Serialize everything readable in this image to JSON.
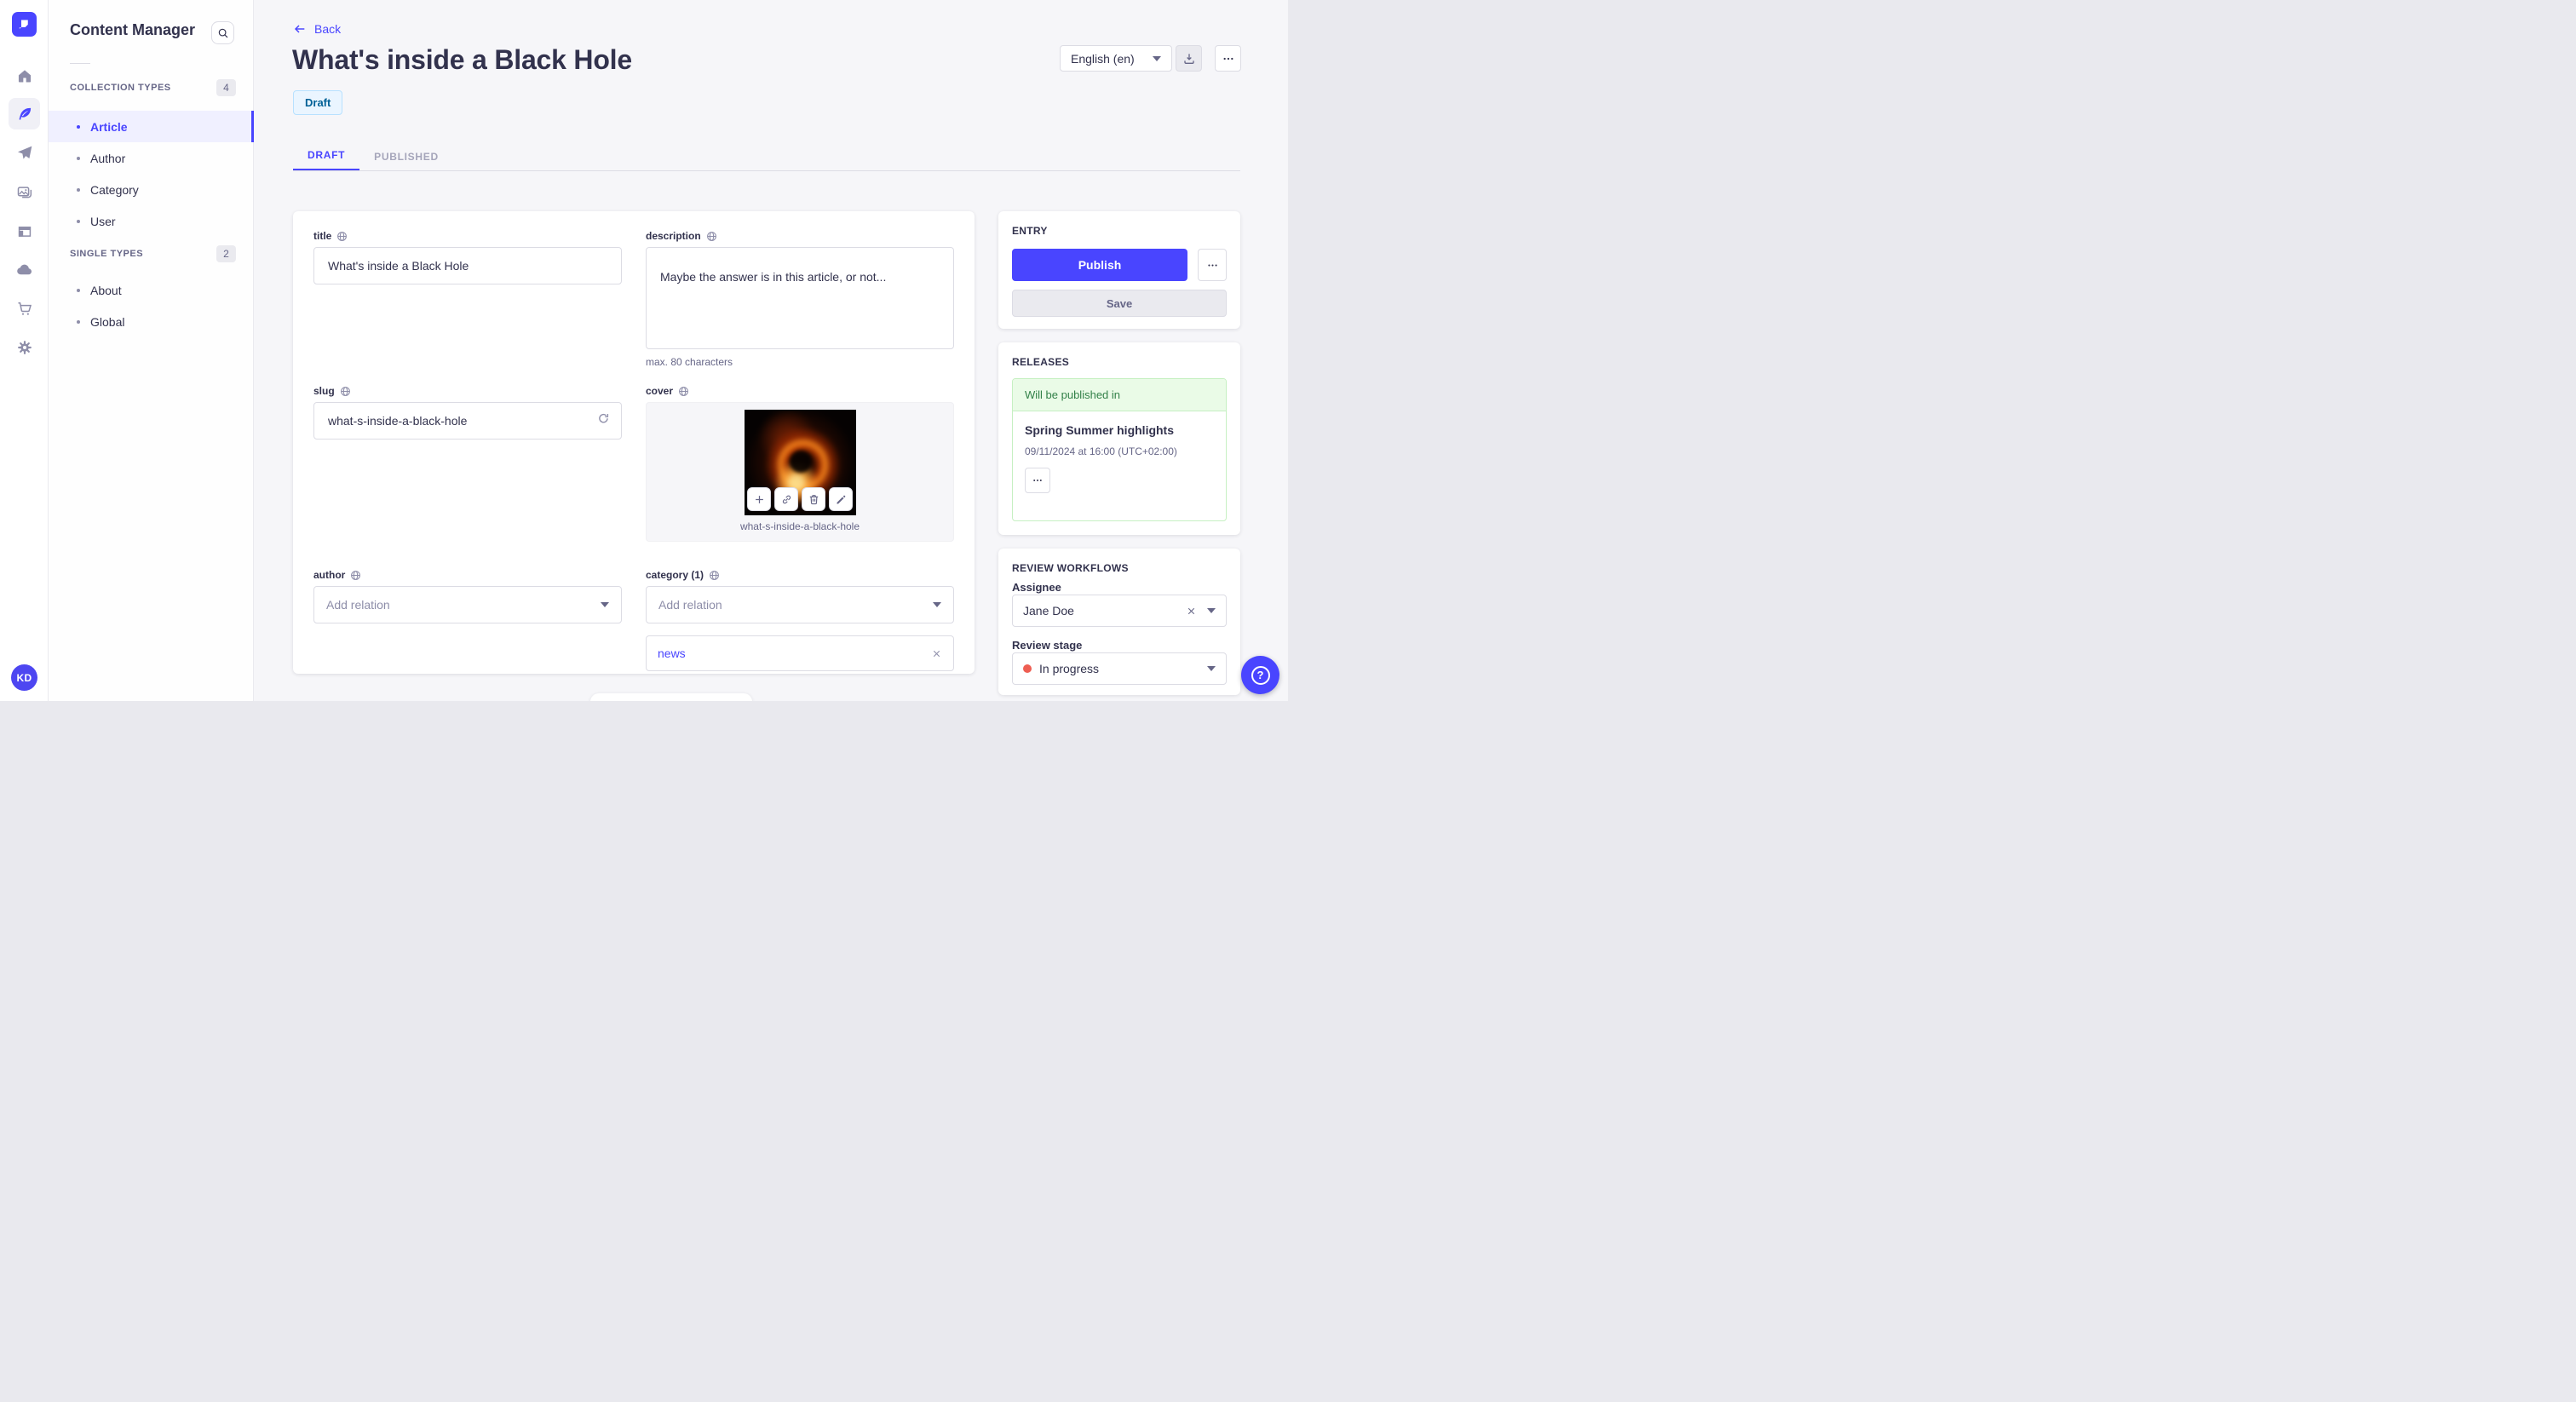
{
  "colors": {
    "accent": "#4945ff",
    "accent_light_bg": "#f0f0ff",
    "draft_bg": "#eaf5ff",
    "draft_border": "#b8e1ff",
    "draft_text": "#006096",
    "success_bg": "#eafbe7",
    "success_border": "#c6f0c2",
    "success_text": "#328048",
    "stage_dot": "#ee5e52",
    "text_dark": "#32324d",
    "text_muted": "#666687"
  },
  "rail": {
    "logo_icon": "strapi-logo",
    "items": [
      {
        "icon": "home-icon"
      },
      {
        "icon": "feather-content-icon",
        "active": true
      },
      {
        "icon": "paper-plane-icon"
      },
      {
        "icon": "media-images-icon"
      },
      {
        "icon": "layout-icon"
      },
      {
        "icon": "cloud-icon"
      },
      {
        "icon": "cart-icon"
      },
      {
        "icon": "gear-icon"
      }
    ],
    "avatar_initials": "KD"
  },
  "sidebar": {
    "title": "Content Manager",
    "search_icon": "search-icon",
    "sections": [
      {
        "label": "COLLECTION TYPES",
        "count": "4",
        "items": [
          {
            "label": "Article",
            "active": true
          },
          {
            "label": "Author"
          },
          {
            "label": "Category"
          },
          {
            "label": "User"
          }
        ]
      },
      {
        "label": "SINGLE TYPES",
        "count": "2",
        "items": [
          {
            "label": "About"
          },
          {
            "label": "Global"
          }
        ]
      }
    ]
  },
  "header": {
    "back_label": "Back",
    "title": "What's inside a Black Hole",
    "status_badge": "Draft",
    "locale_value": "English (en)",
    "tabs": [
      {
        "label": "DRAFT",
        "active": true
      },
      {
        "label": "PUBLISHED",
        "active": false
      }
    ]
  },
  "form": {
    "title": {
      "label": "title",
      "value": "What's inside a Black Hole"
    },
    "description": {
      "label": "description",
      "value": "Maybe the answer is in this article, or not...",
      "helper": "max. 80 characters"
    },
    "slug": {
      "label": "slug",
      "value": "what-s-inside-a-black-hole",
      "refresh_icon": "regenerate-icon"
    },
    "cover": {
      "label": "cover",
      "filename": "what-s-inside-a-black-hole",
      "actions": [
        "add-icon",
        "link-icon",
        "trash-icon",
        "pencil-icon"
      ]
    },
    "author": {
      "label": "author",
      "placeholder": "Add relation"
    },
    "category": {
      "label": "category (1)",
      "placeholder": "Add relation",
      "relations": [
        {
          "label": "news"
        }
      ]
    }
  },
  "entry_panel": {
    "title": "ENTRY",
    "publish_label": "Publish",
    "save_label": "Save"
  },
  "releases_panel": {
    "title": "RELEASES",
    "status": "Will be published in",
    "release_name": "Spring Summer highlights",
    "release_date": "09/11/2024 at 16:00 (UTC+02:00)"
  },
  "review_panel": {
    "title": "REVIEW WORKFLOWS",
    "assignee_label": "Assignee",
    "assignee_value": "Jane Doe",
    "stage_label": "Review stage",
    "stage_value": "In progress"
  },
  "fab": {
    "question": "?"
  }
}
